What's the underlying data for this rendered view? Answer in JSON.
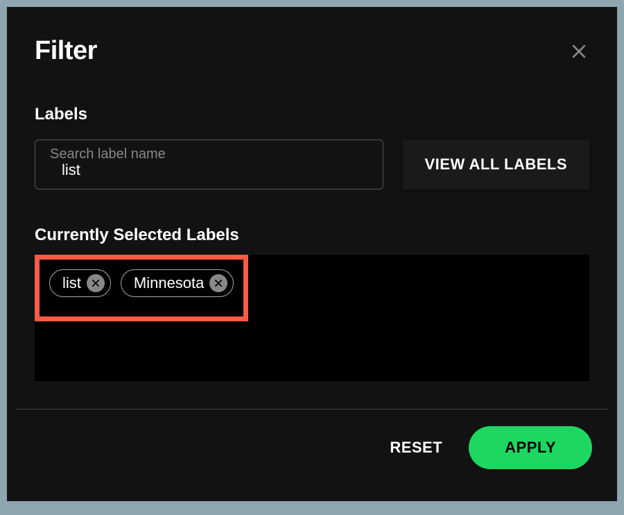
{
  "dialog": {
    "title": "Filter",
    "close_label": "Close"
  },
  "labels_section": {
    "heading": "Labels",
    "search": {
      "placeholder": "Search label name",
      "value": "list"
    },
    "view_all_button": "VIEW ALL LABELS"
  },
  "selected_section": {
    "heading": "Currently Selected Labels",
    "chips": [
      {
        "label": "list"
      },
      {
        "label": "Minnesota"
      }
    ]
  },
  "footer": {
    "reset": "RESET",
    "apply": "APPLY"
  },
  "colors": {
    "accent": "#1ed760",
    "highlight": "#ff5a45",
    "background": "#121212"
  }
}
